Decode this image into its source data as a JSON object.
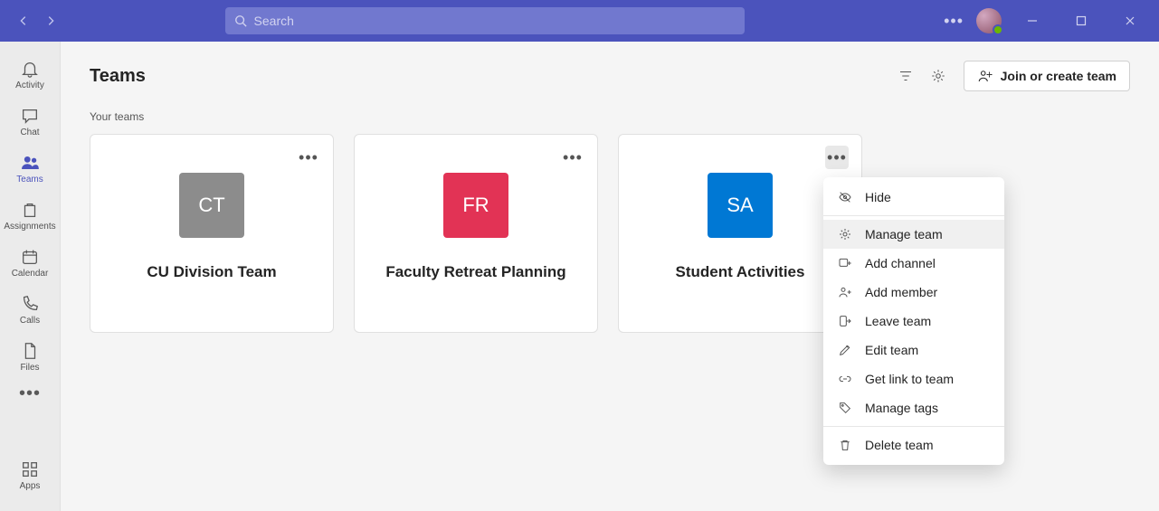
{
  "search": {
    "placeholder": "Search"
  },
  "rail": {
    "activity": "Activity",
    "chat": "Chat",
    "teams": "Teams",
    "assignments": "Assignments",
    "calendar": "Calendar",
    "calls": "Calls",
    "files": "Files",
    "apps": "Apps"
  },
  "page": {
    "title": "Teams",
    "join_label": "Join or create team",
    "section_label": "Your teams"
  },
  "teams": [
    {
      "name": "CU Division Team",
      "initials": "CT",
      "color": "#8c8c8c"
    },
    {
      "name": "Faculty Retreat Planning",
      "initials": "FR",
      "color": "#e23355"
    },
    {
      "name": "Student Activities",
      "initials": "SA",
      "color": "#0078d4"
    }
  ],
  "menu": {
    "hide": "Hide",
    "manage": "Manage team",
    "add_channel": "Add channel",
    "add_member": "Add member",
    "leave": "Leave team",
    "edit": "Edit team",
    "link": "Get link to team",
    "tags": "Manage tags",
    "delete": "Delete team"
  }
}
